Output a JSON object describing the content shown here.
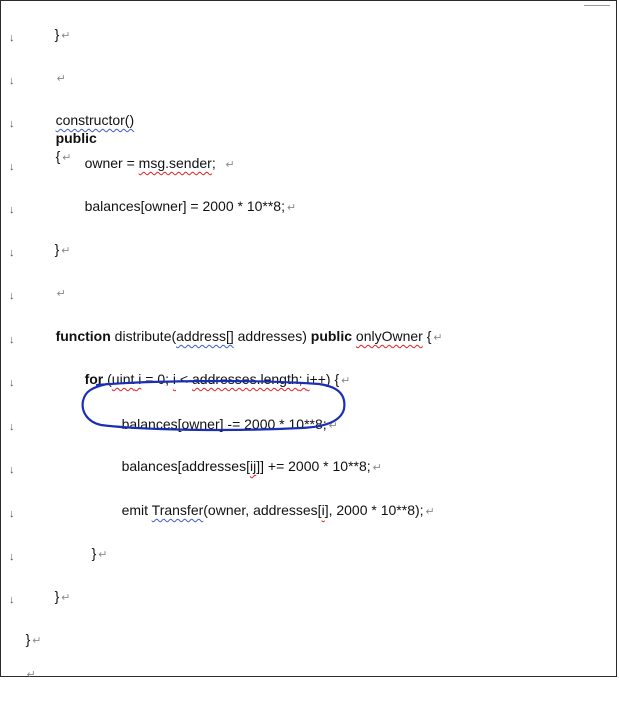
{
  "marks": {
    "paragraph": "↵",
    "line_break": "↓"
  },
  "code": {
    "close_brace_top": "}",
    "constructor_name": "constructor()",
    "kw_public": "public",
    "open_brace": "{",
    "owner_lhs": "owner = ",
    "msg_sender": "msg.sender",
    "semicolon": ";",
    "balances_init": "balances[owner] = 2000 * 10**8;",
    "close_brace": "}",
    "kw_function": "function",
    "distribute_prefix": " distribute(",
    "address_array": "address[]",
    "addresses_param": " addresses) ",
    "only_owner": "onlyOwner",
    "open_brace_space": " {",
    "kw_for": "for",
    "for_open": " (",
    "uint_kw": "uint",
    "for_i": " i",
    "for_assign": " = 0; ",
    "for_i2": "i",
    "for_lt": " < ",
    "addresses_length": "addresses.length",
    "for_semi": "; ",
    "i_inc": "i",
    "inc_rest": "++) {",
    "subtract_line": "balances[owner] -= 2000 * 10**8;",
    "add_prefix": "balances[addresses[",
    "index_ij": "ij",
    "add_suffix": "]] += 2000 * 10**8;",
    "emit_prefix": "emit ",
    "transfer": "Transfer",
    "emit_args_a": "(owner, addresses[",
    "index_i": "i",
    "emit_args_b": "], 2000 * 10**8);",
    "inner_close": "}",
    "outer_close": "}",
    "final_close": "}"
  },
  "colors": {
    "ink": "#111111",
    "highlight_loop": "#1a2fb5",
    "spell_error": "#e02020",
    "grammar_flag": "#3a5ccc"
  }
}
